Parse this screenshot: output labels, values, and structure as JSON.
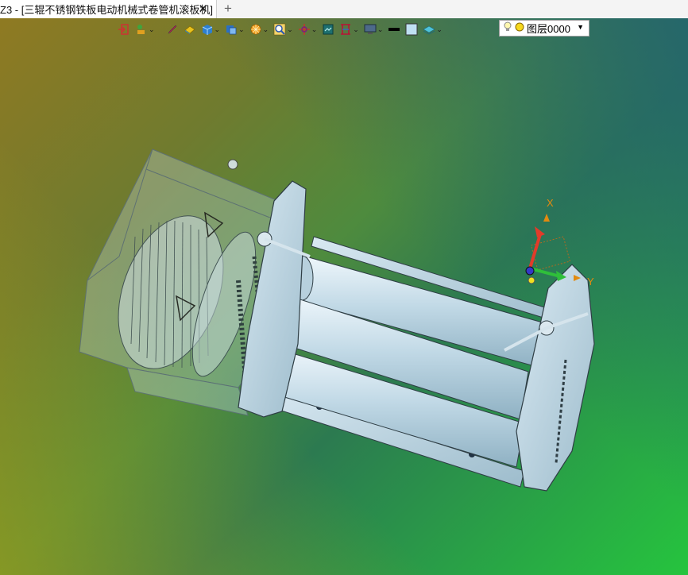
{
  "tab": {
    "title": "Z3 - [三辊不锈钢铁板电动机械式卷管机滚板机]",
    "close": "✕",
    "add": "+"
  },
  "toolbar": {
    "items": [
      {
        "name": "exit-icon"
      },
      {
        "name": "selection-filter-icon"
      },
      {
        "name": "pen-icon"
      },
      {
        "name": "shape-icon"
      },
      {
        "name": "solid-box-icon"
      },
      {
        "name": "view-cube-icon"
      },
      {
        "name": "render-icon"
      },
      {
        "name": "zoom-icon"
      },
      {
        "name": "orient-icon"
      },
      {
        "name": "snapshot-icon"
      },
      {
        "name": "grid-icon"
      },
      {
        "name": "monitor-icon"
      },
      {
        "name": "line-style-icon"
      },
      {
        "name": "color-swatch-icon"
      },
      {
        "name": "layer-stack-icon"
      }
    ]
  },
  "layer": {
    "value": "图层0000"
  },
  "axes": {
    "x_label": "X",
    "y_label": "Y"
  },
  "colors": {
    "model_fill": "#b9d3e0",
    "model_stroke": "#3a4a52",
    "axis_x": "#e23b2a",
    "axis_y": "#2fbf3a",
    "axis_z": "#3338c8"
  }
}
